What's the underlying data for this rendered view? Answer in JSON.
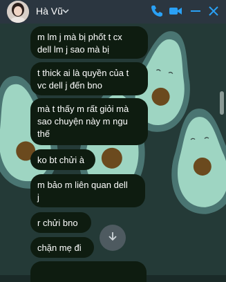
{
  "header": {
    "contact_name": "Hà Vũ",
    "icons": [
      "avatar",
      "chevron-down-icon",
      "phone-icon",
      "video-icon",
      "minimize-icon",
      "close-icon"
    ],
    "accent_color": "#0084ff"
  },
  "messages": [
    {
      "text": "m lm j mà bị phốt t cx\ndell lm j sao mà bị"
    },
    {
      "text": "t thick ai là quyền của t\nvc dell j đến bno"
    },
    {
      "text": "mà t thấy m rất giỏi mà\nsao chuyện này m ngu\nthế"
    },
    {
      "text": "ko bt chửi à"
    },
    {
      "text": "m bảo m liên quan dell\nj"
    },
    {
      "text": "r chửi bno"
    },
    {
      "text": "chặn mẹ đi"
    }
  ],
  "colors": {
    "bubble_bg": "#0e1c10",
    "header_bg": "#2b3640",
    "wallpaper_bg": "#243a37"
  }
}
